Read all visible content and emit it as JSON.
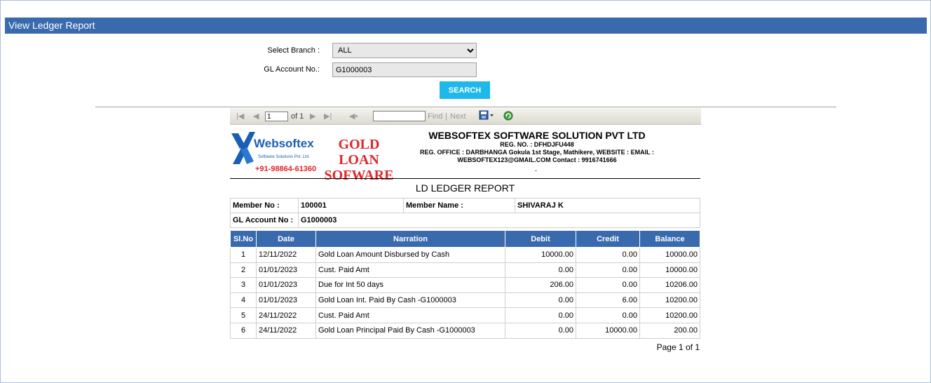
{
  "page_title": "View Ledger Report",
  "form": {
    "branch_label": "Select Branch :",
    "branch_value": "ALL",
    "gl_label": "GL Account No.:",
    "gl_value": "G1000003",
    "search_label": "SEARCH"
  },
  "toolbar": {
    "page_value": "1",
    "of_text": "of 1",
    "find_label": "Find",
    "separator": "|",
    "next_label": "Next"
  },
  "header": {
    "logo_name": "Websoftex",
    "logo_tagline": "Software Solutions Pvt. Ltd.",
    "logo_phone": "+91-98864-61360",
    "product_line1": "GOLD LOAN",
    "product_line2": "SOFWARE",
    "company": "WEBSOFTEX SOFTWARE SOLUTION PVT LTD",
    "reg_no": "REG. NO. : DFHDJFU448",
    "reg_office": "REG. OFFICE : DARBHANGA  Gokula 1st Stage, Mathikere, WEBSITE :          EMAIL : WEBSOFTEX123@GMAIL.COM  Contact : 9916741666",
    "dash": "-"
  },
  "report_title": "LD LEDGER REPORT",
  "member": {
    "member_no_label": "Member No :",
    "member_no": "100001",
    "member_name_label": "Member Name :",
    "member_name": "SHIVARAJ K",
    "gl_label": "GL Account No :",
    "gl_value": "G1000003"
  },
  "ledger": {
    "columns": [
      "Sl.No",
      "Date",
      "Narration",
      "Debit",
      "Credit",
      "Balance"
    ],
    "rows": [
      [
        "1",
        "12/11/2022",
        "Gold Loan Amount Disbursed by Cash",
        "10000.00",
        "0.00",
        "10000.00"
      ],
      [
        "2",
        "01/01/2023",
        "Cust. Paid Amt",
        "0.00",
        "0.00",
        "10000.00"
      ],
      [
        "3",
        "01/01/2023",
        "Due for Int  50 days",
        "206.00",
        "0.00",
        "10206.00"
      ],
      [
        "4",
        "01/01/2023",
        "Gold Loan Int. Paid By Cash -G1000003",
        "0.00",
        "6.00",
        "10200.00"
      ],
      [
        "5",
        "24/11/2022",
        "Cust. Paid Amt",
        "0.00",
        "0.00",
        "10200.00"
      ],
      [
        "6",
        "24/11/2022",
        "Gold Loan Principal Paid By Cash -G1000003",
        "0.00",
        "10000.00",
        "200.00"
      ]
    ]
  },
  "page_footer": "Page 1 of 1",
  "colors": {
    "title_bar": "#3a6aae",
    "search_button": "#1fb8ea",
    "product_red": "#e0262b",
    "logo_blue": "#1a5fb4"
  }
}
